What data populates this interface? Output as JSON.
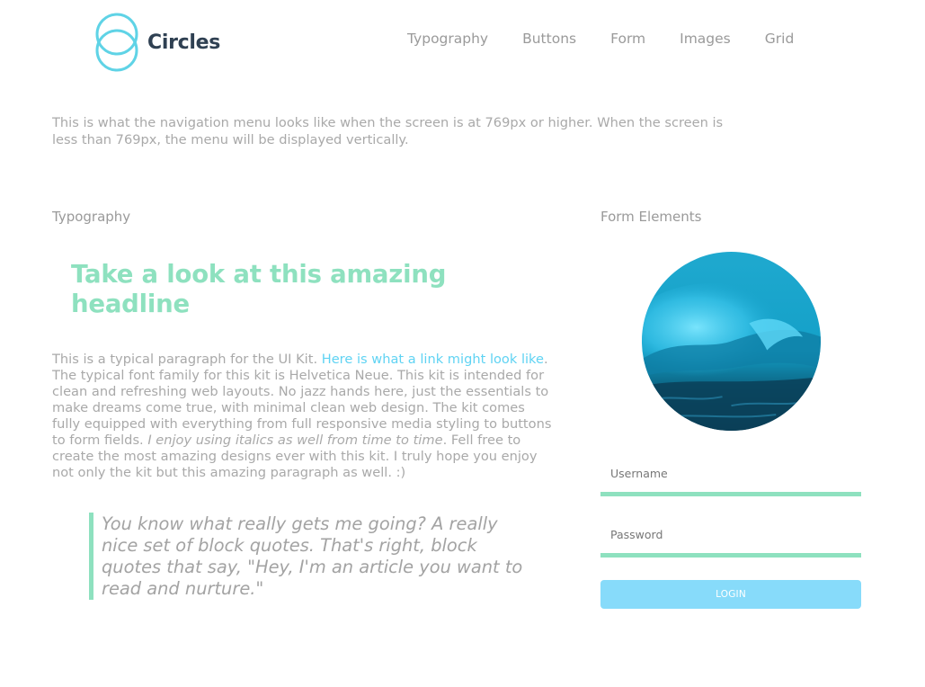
{
  "brand": {
    "name": "Circles",
    "accent": "#8ee1bf",
    "logo_color": "#5fd3e6"
  },
  "nav": {
    "items": [
      "Typography",
      "Buttons",
      "Form",
      "Images",
      "Grid"
    ]
  },
  "intro": {
    "text": "This is what the navigation menu looks like when the screen is at 769px or higher. When the screen is less than 769px, the menu will be displayed vertically."
  },
  "typography": {
    "label": "Typography",
    "headline": "Take a look at this amazing headline",
    "paragraph": {
      "part1": "This is a typical paragraph for the UI Kit. ",
      "link": "Here is what a link might look like",
      "part2": ". The typical font family for this kit is Helvetica Neue. This kit is intended for clean and refreshing web layouts. No jazz hands here, just the essentials to make dreams come true, with minimal clean web design. The kit comes fully equipped with everything from full responsive media styling to buttons to form fields. ",
      "italic": "I enjoy using italics as well from time to time",
      "part3": ". Fell free to create the most amazing designs ever with this kit. I truly hope you enjoy not only the kit but this amazing paragraph as well. :)"
    },
    "blockquote": "You know what really gets me going? A really nice set of block quotes. That's right, block quotes that say, \"Hey, I'm an article you want to read and nurture.\""
  },
  "form": {
    "label": "Form Elements",
    "username_placeholder": "Username",
    "password_placeholder": "Password",
    "login_label": "LOGIN",
    "login_color": "#87dbfa"
  }
}
